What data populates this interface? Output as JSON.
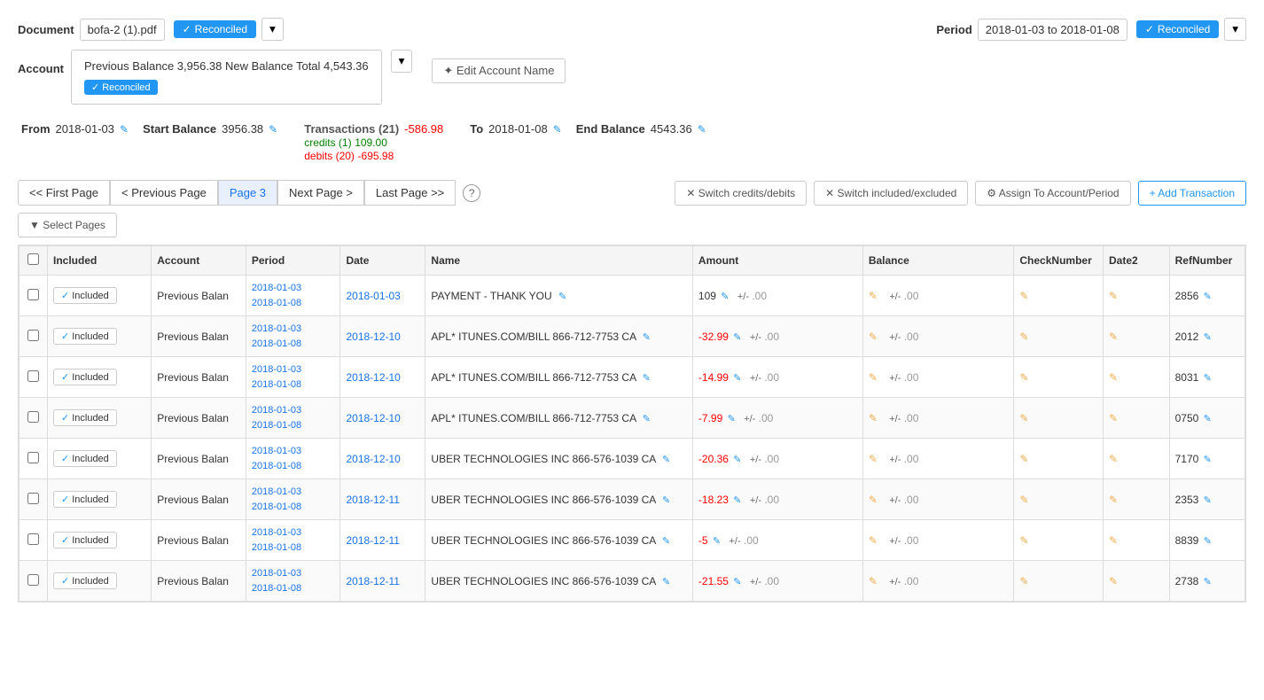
{
  "document": {
    "label": "Document",
    "filename": "bofa-2 (1).pdf",
    "reconciled_label": "Reconciled",
    "dropdown_symbol": "▾"
  },
  "account": {
    "label": "Account",
    "info": "Previous Balance 3,956.38 New Balance Total 4,543.36",
    "reconciled_label": "Reconciled",
    "edit_btn_label": "✦ Edit Account Name",
    "dropdown_symbol": "▾"
  },
  "period": {
    "label": "Period",
    "value": "2018-01-03 to 2018-01-08",
    "reconciled_label": "Reconciled",
    "dropdown_symbol": "▾"
  },
  "stats": {
    "from_label": "From",
    "from_date": "2018-01-03",
    "start_balance_label": "Start Balance",
    "start_balance_value": "3956.38",
    "transactions_label": "Transactions (21)",
    "transactions_amount": "-586.98",
    "credits_label": "credits (1)",
    "credits_amount": "109.00",
    "debits_label": "debits (20)",
    "debits_amount": "-695.98",
    "to_label": "To",
    "to_date": "2018-01-08",
    "end_balance_label": "End Balance",
    "end_balance_value": "4543.36"
  },
  "pagination": {
    "first_page": "<< First Page",
    "prev_page": "< Previous Page",
    "current_page": "Page 3",
    "next_page": "Next Page >",
    "last_page": "Last Page >>",
    "help": "?"
  },
  "actions": {
    "select_pages": "▼ Select Pages",
    "switch_credits": "✕ Switch credits/debits",
    "switch_included": "✕ Switch included/excluded",
    "assign_account": "⚙ Assign To Account/Period",
    "add_transaction": "+ Add Transaction"
  },
  "table": {
    "headers": [
      "Included",
      "Account",
      "Period",
      "Date",
      "Name",
      "Amount",
      "Balance",
      "CheckNumber",
      "Date2",
      "RefNumber"
    ],
    "rows": [
      {
        "included": "Included",
        "account": "Previous Balan",
        "period_from": "2018-01-03",
        "period_to": "2018-01-08",
        "date": "2018-01-03",
        "name": "PAYMENT - THANK YOU",
        "amount": "109",
        "amount_sign": "+",
        "amount_decimal": ".00",
        "balance_edit": true,
        "balance_pm": "+/-",
        "balance_decimal": ".00",
        "check_edit": true,
        "date2_edit": true,
        "ref_number": "2856"
      },
      {
        "included": "Included",
        "account": "Previous Balan",
        "period_from": "2018-01-03",
        "period_to": "2018-01-08",
        "date": "2018-12-10",
        "name": "APL* ITUNES.COM/BILL 866-712-7753 CA",
        "amount": "-32.99",
        "amount_sign": "+/-",
        "amount_decimal": ".00",
        "balance_edit": true,
        "balance_pm": "+/-",
        "balance_decimal": ".00",
        "check_edit": true,
        "date2_edit": true,
        "ref_number": "2012"
      },
      {
        "included": "Included",
        "account": "Previous Balan",
        "period_from": "2018-01-03",
        "period_to": "2018-01-08",
        "date": "2018-12-10",
        "name": "APL* ITUNES.COM/BILL 866-712-7753 CA",
        "amount": "-14.99",
        "amount_sign": "+/-",
        "amount_decimal": ".00",
        "balance_edit": true,
        "balance_pm": "+/-",
        "balance_decimal": ".00",
        "check_edit": true,
        "date2_edit": true,
        "ref_number": "8031"
      },
      {
        "included": "Included",
        "account": "Previous Balan",
        "period_from": "2018-01-03",
        "period_to": "2018-01-08",
        "date": "2018-12-10",
        "name": "APL* ITUNES.COM/BILL 866-712-7753 CA",
        "amount": "-7.99",
        "amount_sign": "+/-",
        "amount_decimal": ".00",
        "balance_edit": true,
        "balance_pm": "+/-",
        "balance_decimal": ".00",
        "check_edit": true,
        "date2_edit": true,
        "ref_number": "0750"
      },
      {
        "included": "Included",
        "account": "Previous Balan",
        "period_from": "2018-01-03",
        "period_to": "2018-01-08",
        "date": "2018-12-10",
        "name": "UBER TECHNOLOGIES INC 866-576-1039 CA",
        "amount": "-20.36",
        "amount_sign": "+/-",
        "amount_decimal": ".00",
        "balance_edit": true,
        "balance_pm": "+/-",
        "balance_decimal": ".00",
        "check_edit": true,
        "date2_edit": true,
        "ref_number": "7170"
      },
      {
        "included": "Included",
        "account": "Previous Balan",
        "period_from": "2018-01-03",
        "period_to": "2018-01-08",
        "date": "2018-12-11",
        "name": "UBER TECHNOLOGIES INC 866-576-1039 CA",
        "amount": "-18.23",
        "amount_sign": "+/-",
        "amount_decimal": ".00",
        "balance_edit": true,
        "balance_pm": "+/-",
        "balance_decimal": ".00",
        "check_edit": true,
        "date2_edit": true,
        "ref_number": "2353"
      },
      {
        "included": "Included",
        "account": "Previous Balan",
        "period_from": "2018-01-03",
        "period_to": "2018-01-08",
        "date": "2018-12-11",
        "name": "UBER TECHNOLOGIES INC 866-576-1039 CA",
        "amount": "-5",
        "amount_sign": "+/-",
        "amount_decimal": ".00",
        "balance_edit": true,
        "balance_pm": "+/-",
        "balance_decimal": ".00",
        "check_edit": true,
        "date2_edit": true,
        "ref_number": "8839"
      },
      {
        "included": "Included",
        "account": "Previous Balan",
        "period_from": "2018-01-03",
        "period_to": "2018-01-08",
        "date": "2018-12-11",
        "name": "UBER TECHNOLOGIES INC 866-576-1039 CA",
        "amount": "-21.55",
        "amount_sign": "+/-",
        "amount_decimal": ".00",
        "balance_edit": true,
        "balance_pm": "+/-",
        "balance_decimal": ".00",
        "check_edit": true,
        "date2_edit": true,
        "ref_number": "2738"
      }
    ]
  }
}
